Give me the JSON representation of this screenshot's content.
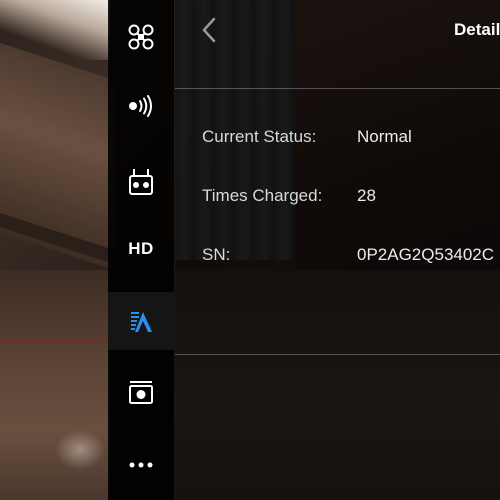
{
  "header": {
    "title": "Details"
  },
  "sidebar": {
    "items": [
      {
        "name": "aircraft",
        "icon": "drone-icon"
      },
      {
        "name": "signal",
        "icon": "signal-broadcast-icon"
      },
      {
        "name": "remote-controller",
        "icon": "remote-controller-icon"
      },
      {
        "name": "hd",
        "label": "HD"
      },
      {
        "name": "battery",
        "icon": "battery-icon",
        "active": true,
        "accent": "#2e8ef0"
      },
      {
        "name": "camera",
        "icon": "camera-icon"
      },
      {
        "name": "more",
        "icon": "more-icon"
      }
    ]
  },
  "details": {
    "rows": [
      {
        "label": "Current Status:",
        "value": "Normal"
      },
      {
        "label": "Times Charged:",
        "value": "28"
      },
      {
        "label": "SN:",
        "value": "0P2AG2Q53402C"
      }
    ]
  },
  "colors": {
    "accent": "#2e8ef0",
    "sidebar_bg": "#000000",
    "text": "#ffffff"
  }
}
